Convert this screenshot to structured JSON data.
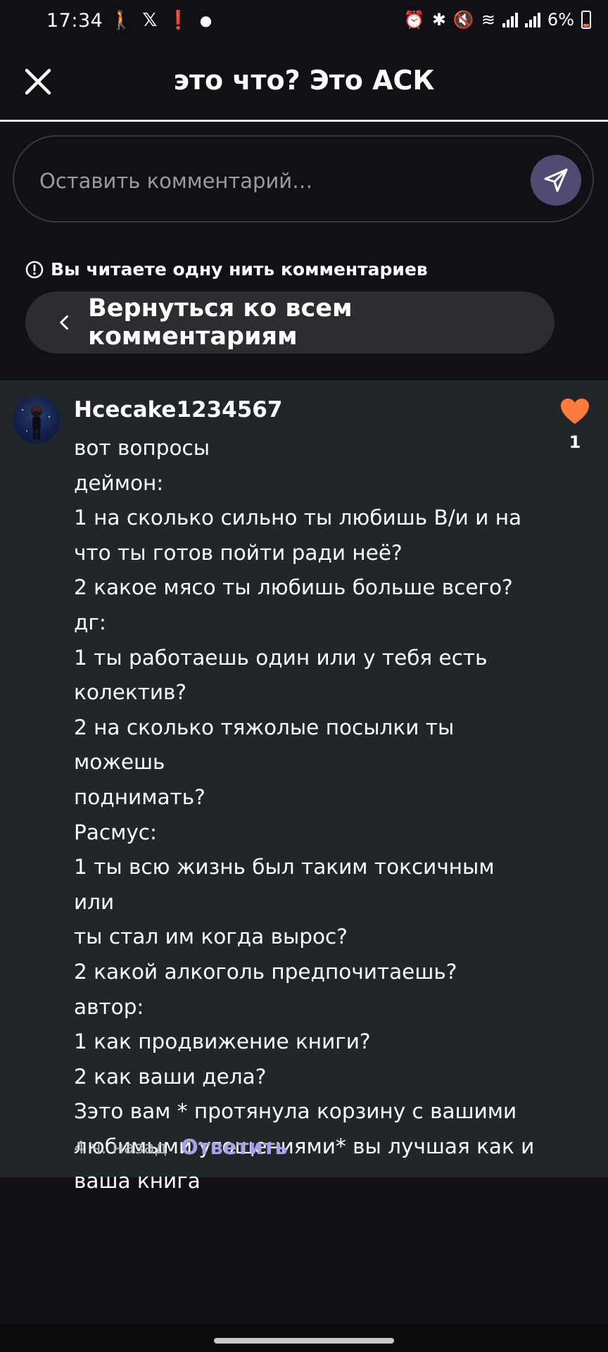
{
  "status_bar": {
    "time": "17:34",
    "battery": "6%"
  },
  "header": {
    "title": "это что? Это АСК"
  },
  "comment_input": {
    "placeholder": "Оставить комментарий…"
  },
  "thread": {
    "notice": "Вы читаете одну нить комментариев",
    "back_label": "Вернуться ко всем комментариям"
  },
  "comment": {
    "username": "Hcecake1234567",
    "likes": "1",
    "text": "вот вопросы\nдеймон:\n1 на сколько сильно ты любишь В/и и на\nчто ты готов пойти ради неё?\n2 какое мясо ты любишь больше всего?\nдг:\n1 ты работаешь один или у тебя есть\nколектив?\n2 на сколько тяжолые посылки ты можешь\nподнимать?\nРасмус:\n1 ты всю жизнь был таким токсичным или\nты стал им когда вырос?\n2 какой алкоголь предпочитаешь?\nавтор:\n1 как продвижение книги?\n2 как ваши дела?\nЗэто вам * протянула корзину с вашими\nлюбимыми угощениями* вы лучшая как и\nваша книга",
    "time_ago": "4 ч. назад",
    "reply_label": "Ответить"
  },
  "colors": {
    "accent": "#a6a0e6",
    "like": "#ff7a3d",
    "send_button": "#4f4b72"
  }
}
